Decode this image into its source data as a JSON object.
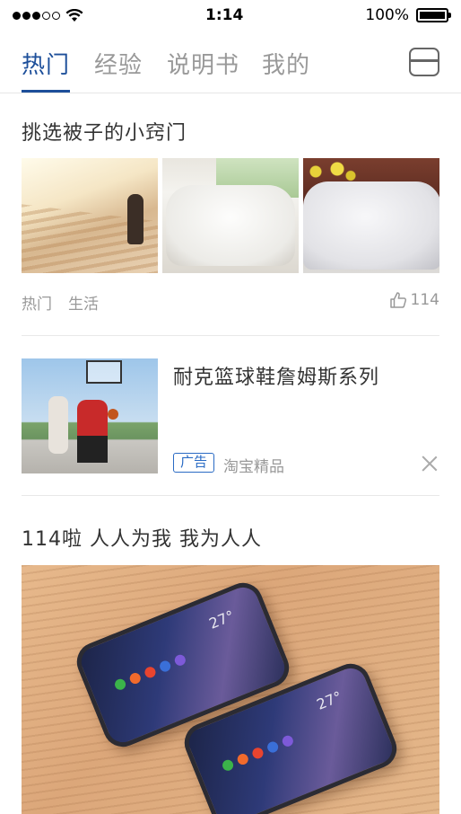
{
  "status_bar": {
    "time": "1:14",
    "battery": "100%"
  },
  "tabs": [
    {
      "label": "热门",
      "active": true
    },
    {
      "label": "经验",
      "active": false
    },
    {
      "label": "说明书",
      "active": false
    },
    {
      "label": "我的",
      "active": false
    }
  ],
  "feed": {
    "article1": {
      "title": "挑选被子的小窍门",
      "tag1": "热门",
      "tag2": "生活",
      "likes": "114"
    },
    "ad": {
      "title": "耐克篮球鞋詹姆斯系列",
      "badge": "广告",
      "source": "淘宝精品"
    },
    "article2": {
      "title": "114啦 人人为我 我为人人"
    }
  },
  "colors": {
    "accent": "#1d4f9a",
    "ad_blue": "#2a6bc4",
    "muted": "#999999"
  }
}
